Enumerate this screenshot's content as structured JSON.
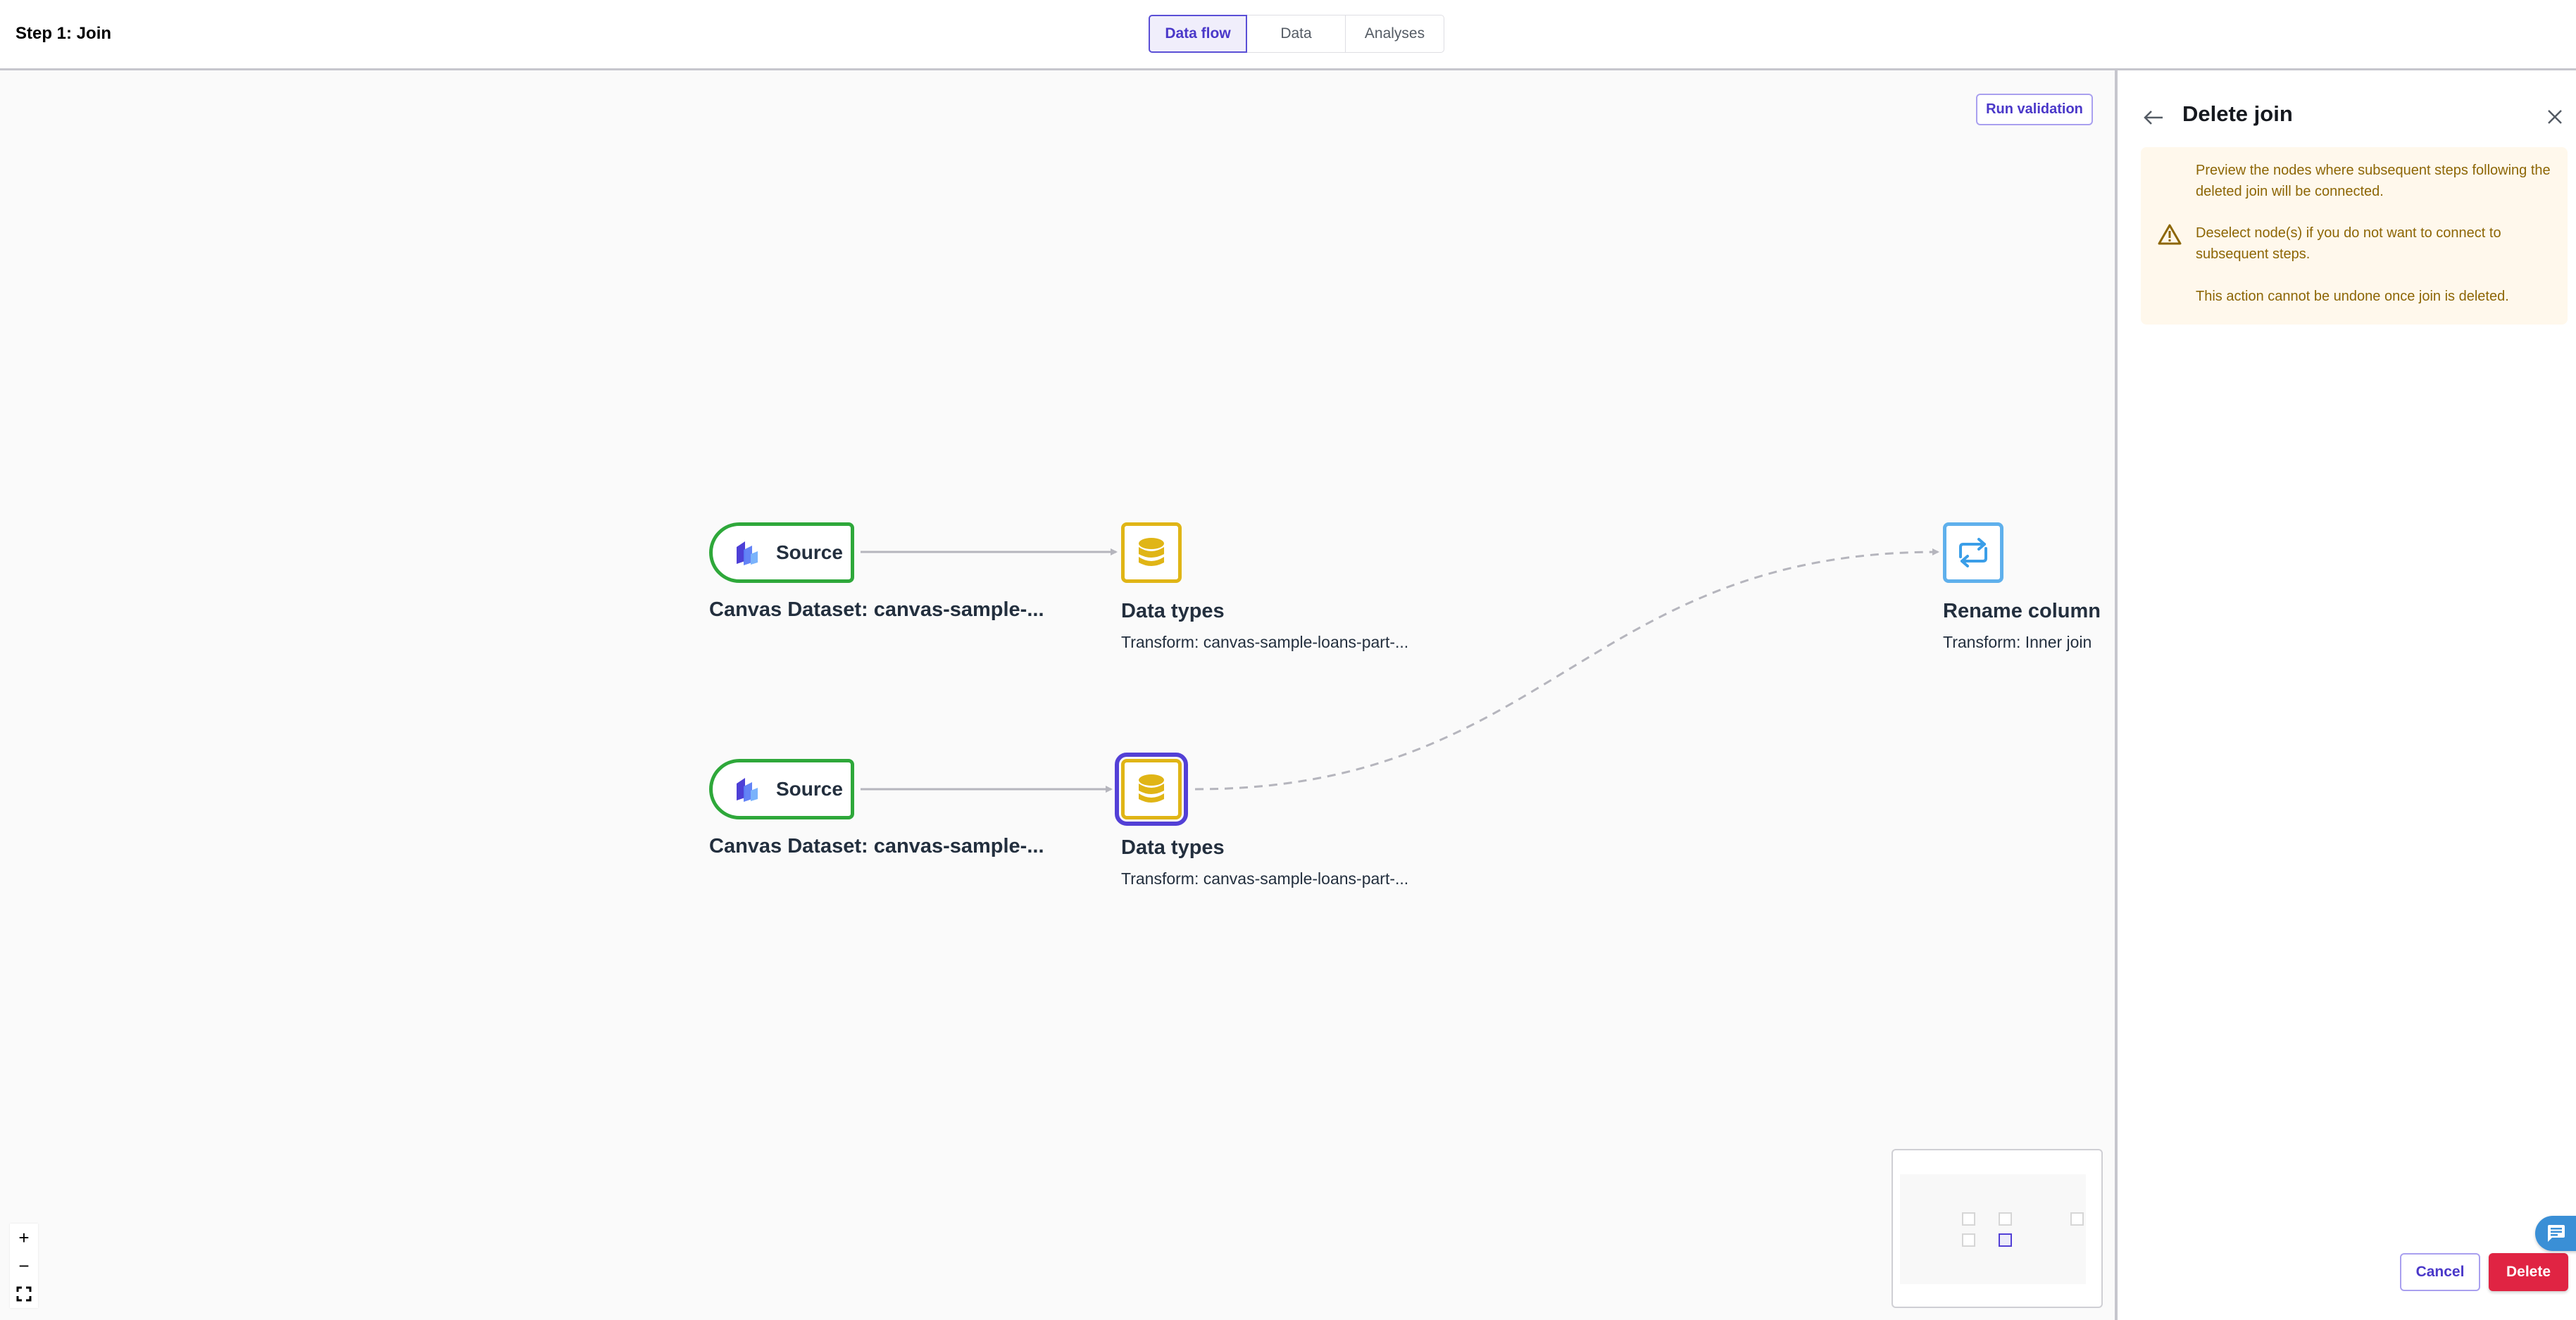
{
  "header": {
    "title": "Step 1: Join",
    "tabs": [
      {
        "label": "Data flow",
        "active": true
      },
      {
        "label": "Data",
        "active": false
      },
      {
        "label": "Analyses",
        "active": false
      }
    ]
  },
  "canvas": {
    "run_validation_label": "Run validation",
    "nodes": [
      {
        "id": "source-1",
        "type": "source",
        "box_label": "Source",
        "title": "Canvas Dataset: canvas-sample-..."
      },
      {
        "id": "datatypes-1",
        "type": "transform",
        "title": "Data types",
        "subtitle": "Transform: canvas-sample-loans-part-..."
      },
      {
        "id": "rename-column",
        "type": "transform",
        "title": "Rename column",
        "subtitle": "Transform: Inner join"
      },
      {
        "id": "source-2",
        "type": "source",
        "box_label": "Source",
        "title": "Canvas Dataset: canvas-sample-..."
      },
      {
        "id": "datatypes-2",
        "type": "transform",
        "title": "Data types",
        "subtitle": "Transform: canvas-sample-loans-part-...",
        "selected": true
      }
    ],
    "edges": [
      {
        "from": "source-1",
        "to": "datatypes-1",
        "style": "solid"
      },
      {
        "from": "source-2",
        "to": "datatypes-2",
        "style": "solid"
      },
      {
        "from": "datatypes-2",
        "to": "rename-column",
        "style": "dashed"
      }
    ],
    "zoom_controls": {
      "zoom_in": "+",
      "zoom_out": "−"
    }
  },
  "panel": {
    "title": "Delete join",
    "alert": {
      "lines": [
        "Preview the nodes where subsequent steps following the deleted join will be connected.",
        "Deselect node(s) if you do not want to connect to subsequent steps.",
        "This action cannot be undone once join is deleted."
      ]
    },
    "cancel_label": "Cancel",
    "delete_label": "Delete"
  },
  "colors": {
    "accent": "#5340d6",
    "source_border": "#2ea83a",
    "transform_border": "#e0b516",
    "rename_border": "#5fb0ec",
    "delete": "#e02443",
    "alert_bg": "#fff8ec",
    "alert_text": "#8d6605"
  }
}
